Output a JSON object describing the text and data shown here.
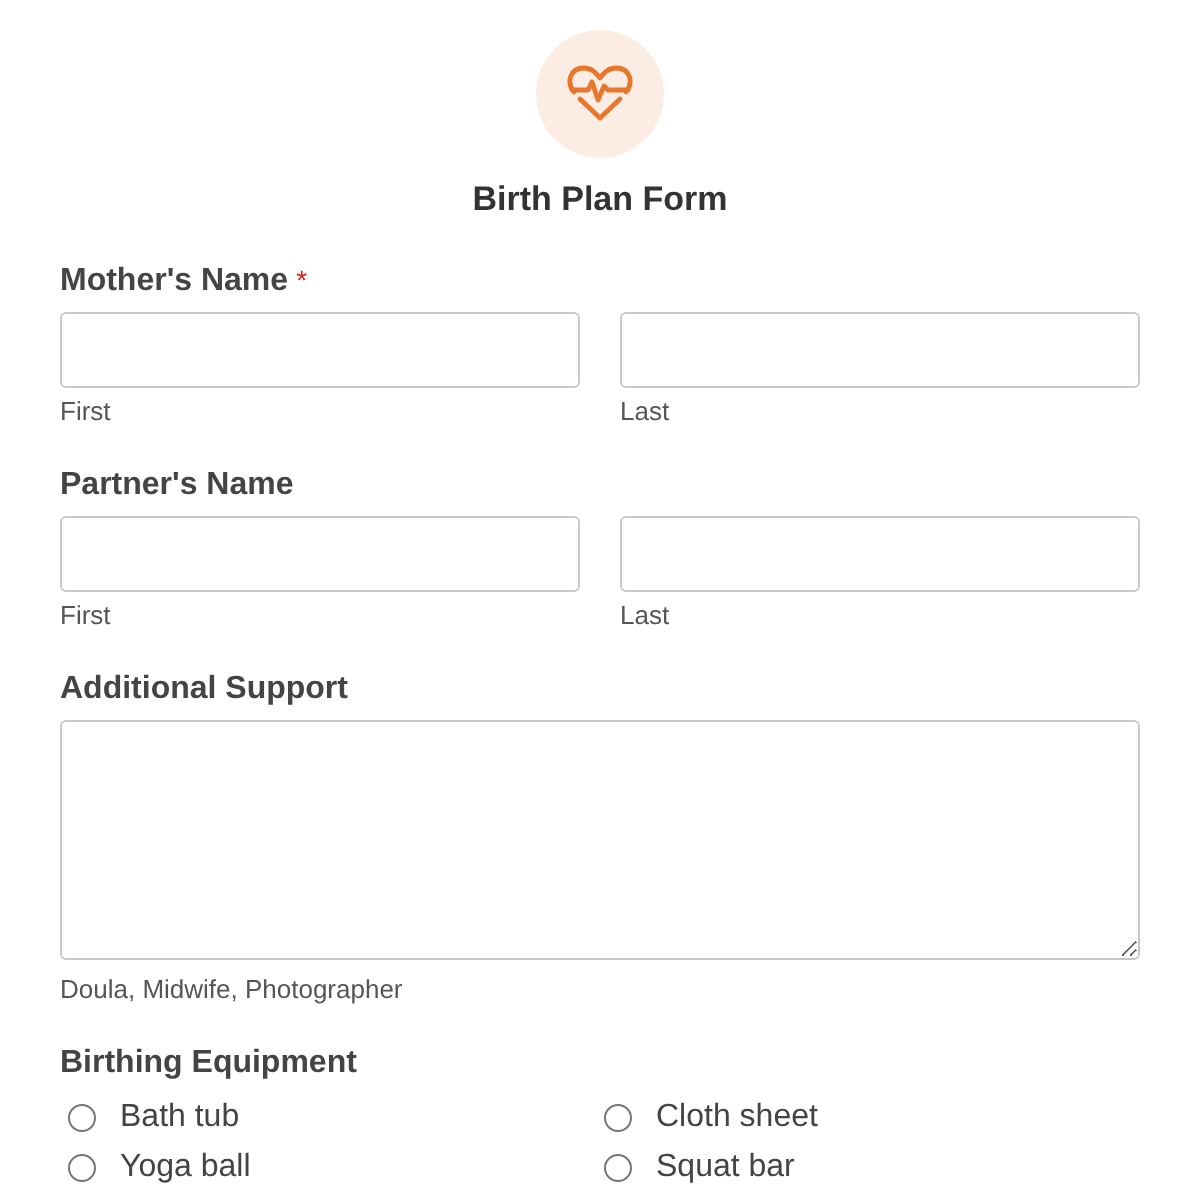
{
  "form": {
    "title": "Birth Plan Form"
  },
  "fields": [
    {
      "kind": "name",
      "label": "Mother's Name",
      "required": true,
      "parts": [
        {
          "sublabel": "First"
        },
        {
          "sublabel": "Last"
        }
      ]
    },
    {
      "kind": "name",
      "label": "Partner's Name",
      "required": false,
      "parts": [
        {
          "sublabel": "First"
        },
        {
          "sublabel": "Last"
        }
      ]
    },
    {
      "kind": "textarea",
      "label": "Additional Support",
      "required": false,
      "sublabel": "Doula, Midwife, Photographer"
    },
    {
      "kind": "radio",
      "label": "Birthing Equipment",
      "required": false,
      "options": [
        {
          "label": "Bath tub",
          "selected": false
        },
        {
          "label": "Cloth sheet",
          "selected": false
        },
        {
          "label": "Yoga ball",
          "selected": false
        },
        {
          "label": "Squat bar",
          "selected": false
        }
      ]
    }
  ],
  "required_mark": "*"
}
